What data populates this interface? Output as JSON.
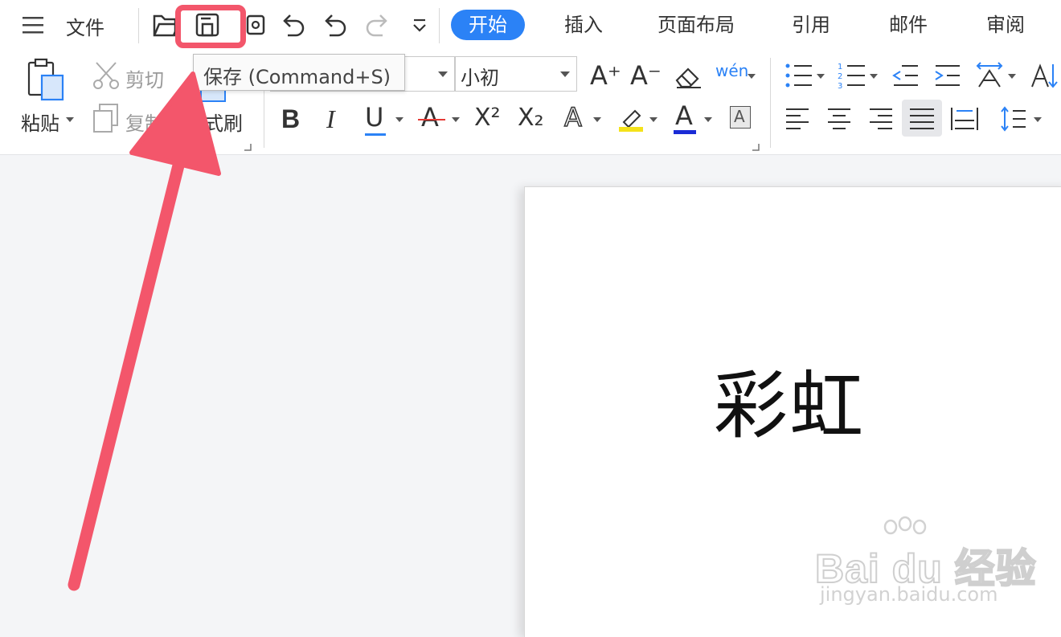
{
  "menu": {
    "file_label": "文件",
    "icons": [
      "menu-icon",
      "open-folder-icon",
      "save-icon",
      "print-icon",
      "undo-icon",
      "undo-alt-icon",
      "redo-icon",
      "more-dropdown-icon"
    ]
  },
  "tabs": [
    {
      "label": "开始",
      "active": true
    },
    {
      "label": "插入",
      "active": false
    },
    {
      "label": "页面布局",
      "active": false
    },
    {
      "label": "引用",
      "active": false
    },
    {
      "label": "邮件",
      "active": false
    },
    {
      "label": "审阅",
      "active": false
    }
  ],
  "clipboard": {
    "paste_label": "粘贴",
    "cut_label": "剪切",
    "copy_label": "复制",
    "format_painter_label": "格式刷"
  },
  "font": {
    "size_value": "小初",
    "bold_glyph": "B",
    "italic_glyph": "I",
    "underline_glyph": "U",
    "strikethrough_glyph": "A",
    "superscript_glyph": "X²",
    "subscript_glyph": "X₂",
    "text_effect_glyph": "A",
    "font_color_glyph": "A",
    "char_border_glyph": "A",
    "grow_glyph": "A⁺",
    "shrink_glyph": "A⁻",
    "phonetic_glyph": "wén",
    "highlight_color": "#f4e21a",
    "font_color": "#1a2bd6",
    "strike_color": "#e53935",
    "underline_color": "#2b82f6"
  },
  "tooltip": {
    "text": "保存 (Command+S)"
  },
  "document": {
    "text": "彩虹"
  },
  "watermark": {
    "brand": "Bai du 经验",
    "url": "jingyan.baidu.com"
  },
  "colors": {
    "accent": "#2b82f6",
    "annotation": "#f3566b"
  }
}
